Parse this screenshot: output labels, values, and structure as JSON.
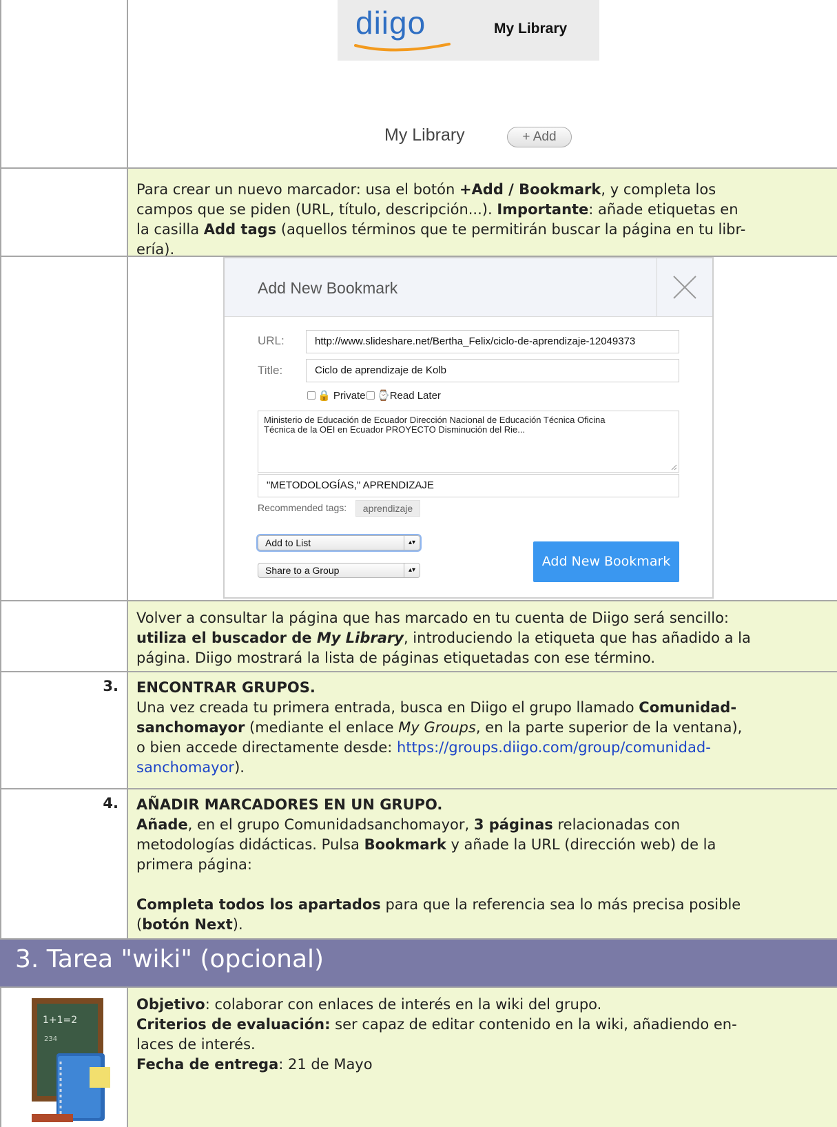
{
  "banner": {
    "logo": "diigo",
    "title": "My Library"
  },
  "library_toolbar": {
    "title": "My Library",
    "add_button": "+ Add"
  },
  "intro_text": {
    "line1_a": "Para crear un nuevo marcador: usa el botón ",
    "line1_b": "+Add / Bookmark",
    "line1_c": ", y completa los",
    "line2_a": "campos que se piden (URL, título, descripción...). ",
    "line2_b": "Importante",
    "line2_c": ": añade etiquetas en",
    "line3_a": "la casilla ",
    "line3_b": "Add tags",
    "line3_c": " (aquellos términos que te permitirán buscar la página en tu libr-",
    "line4": "ería)."
  },
  "dialog": {
    "title": "Add New Bookmark",
    "url_label": "URL:",
    "url_value": "http://www.slideshare.net/Bertha_Felix/ciclo-de-aprendizaje-12049373",
    "title_label": "Title:",
    "title_value": "Ciclo de aprendizaje de Kolb",
    "private_label": "Private",
    "read_later_label": "Read Later",
    "description_line1": "Ministerio de Educación de Ecuador  Dirección Nacional de Educación Técnica    Oficina",
    "description_line2": "Técnica de la OEI en Ecuador              PROYECTO Disminución del Rie...",
    "tags_value": "\"METODOLOGÍAS,\" APRENDIZAJE",
    "recommended_label": "Recommended tags:",
    "recommended_tag": "aprendizaje",
    "add_to_list": "Add to List",
    "share_to_group": "Share to a Group",
    "submit": "Add New Bookmark"
  },
  "search_text": {
    "line1": "Volver a consultar la página que has marcado en tu cuenta de Diigo será sencillo:",
    "line2_a": "utiliza el buscador de ",
    "line2_b": "My Library",
    "line2_c": ", introduciendo la etiqueta que has añadido a la",
    "line3": "página. Diigo mostrará la lista de páginas etiquetadas con ese término."
  },
  "step3": {
    "number": "3.",
    "heading": "ENCONTRAR GRUPOS.",
    "line1_a": "Una vez creada tu primera entrada, busca en Diigo el grupo llamado ",
    "line1_b": "Comunidad-",
    "line2_a": "sanchomayor",
    "line2_b": " (mediante el enlace ",
    "line2_c": "My Groups",
    "line2_d": ", en la parte superior de la ventana),",
    "line3_a": "o bien accede directamente desde: ",
    "link_part1": "https://groups.diigo.com/group/comunidad-",
    "link_part2": "sanchomayor",
    "line4_end": ")."
  },
  "step4": {
    "number": "4.",
    "heading": "AÑADIR MARCADORES EN UN GRUPO.",
    "line1_a": "Añade",
    "line1_b": ", en el grupo Comunidadsanchomayor, ",
    "line1_c": "3 páginas",
    "line1_d": " relacionadas con",
    "line2_a": "metodologías didácticas. Pulsa ",
    "line2_b": "Bookmark",
    "line2_c": " y añade la URL (dirección web) de la",
    "line3": "primera página:",
    "line4_a": "Completa todos los apartados",
    "line4_b": " para que la referencia sea lo más precisa posible",
    "line5_a": "(",
    "line5_b": "botón Next",
    "line5_c": ")."
  },
  "section_heading": "3. Tarea \"wiki\" (opcional)",
  "task": {
    "objective_label": "Objetivo",
    "objective_text": ": colaborar con enlaces de interés en la wiki del grupo.",
    "criteria_label": "Criterios de evaluación:",
    "criteria_text": " ser capaz de editar contenido en la wiki, añadiendo en-",
    "criteria_text2": "laces de interés.",
    "date_label": "Fecha de entrega",
    "date_text": ": 21 de Mayo"
  },
  "colors": {
    "green_cell": "#f1f7d3",
    "section_bg": "#7a7aa6",
    "link": "#1d45c8",
    "dialog_button": "#3a97f0"
  }
}
